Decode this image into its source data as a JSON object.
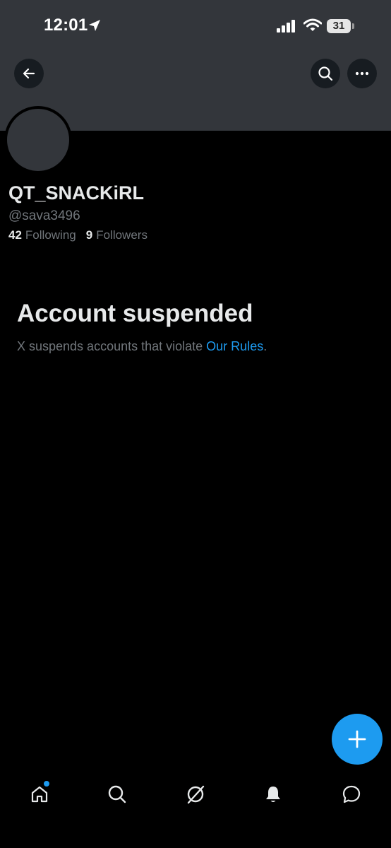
{
  "status_bar": {
    "time": "12:01",
    "battery": "31"
  },
  "header": {
    "back_icon": "arrow-left-icon",
    "search_icon": "search-icon",
    "more_icon": "more-horizontal-icon"
  },
  "profile": {
    "display_name": "QT_SNACKiRL",
    "handle": "@sava3496",
    "following_count": "42",
    "following_label": "Following",
    "followers_count": "9",
    "followers_label": "Followers"
  },
  "suspension": {
    "title": "Account suspended",
    "description_prefix": "X suspends accounts that violate ",
    "rules_link": "Our Rules",
    "description_suffix": "."
  },
  "fab": {
    "icon": "plus-icon"
  },
  "bottom_nav": {
    "items": [
      "home-icon",
      "search-icon",
      "grok-icon",
      "notifications-bell-icon",
      "messages-icon"
    ],
    "home_has_notification_dot": true
  },
  "colors": {
    "accent": "#1d9bf0",
    "banner": "#33363b",
    "background": "#000000",
    "text_primary": "#e7e9ea",
    "text_secondary": "#71767b"
  }
}
